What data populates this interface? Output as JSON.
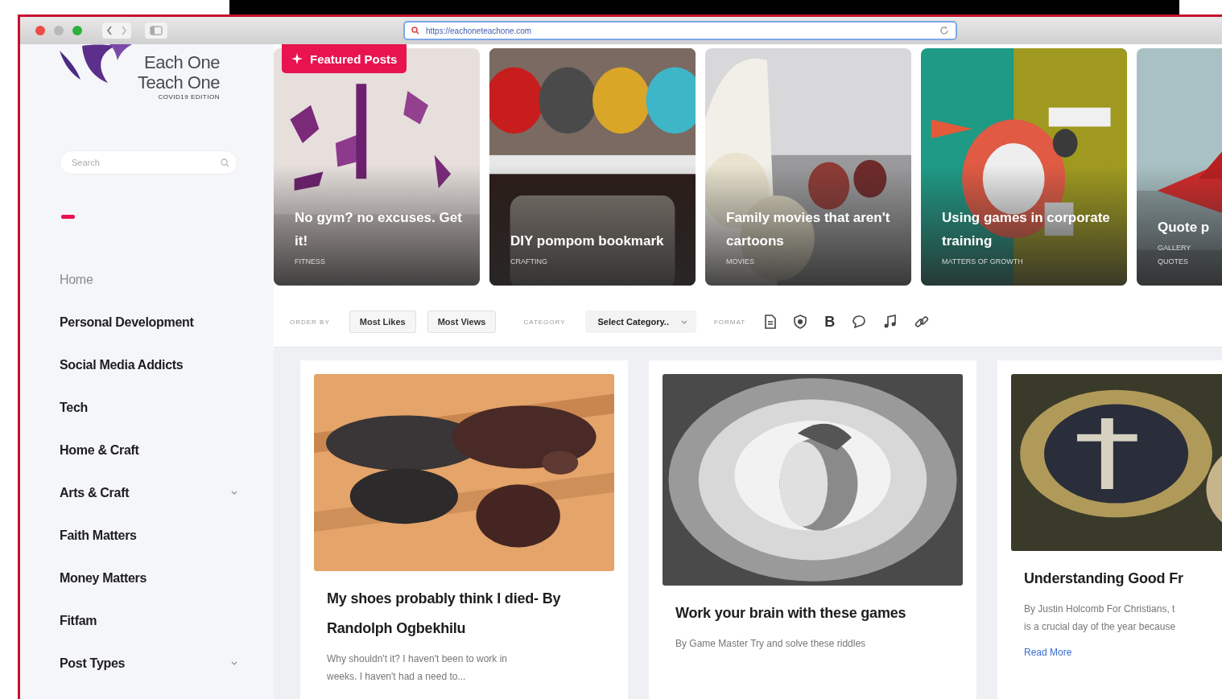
{
  "browser": {
    "url": "https://eachoneteachone.com"
  },
  "sidebar": {
    "logo": {
      "line_1": "Each One",
      "line_2": "Teach One",
      "edition": "COVID19 EDITION"
    },
    "search": {
      "placeholder": "Search"
    },
    "items": [
      {
        "label": "Home",
        "selected": true,
        "has_submenu": false
      },
      {
        "label": "Personal Development",
        "selected": false,
        "has_submenu": false
      },
      {
        "label": "Social Media Addicts",
        "selected": false,
        "has_submenu": false
      },
      {
        "label": "Tech",
        "selected": false,
        "has_submenu": false
      },
      {
        "label": "Home & Craft",
        "selected": false,
        "has_submenu": false
      },
      {
        "label": "Arts & Craft",
        "selected": false,
        "has_submenu": true
      },
      {
        "label": "Faith Matters",
        "selected": false,
        "has_submenu": false
      },
      {
        "label": "Money Matters",
        "selected": false,
        "has_submenu": false
      },
      {
        "label": "Fitfam",
        "selected": false,
        "has_submenu": false
      },
      {
        "label": "Post Types",
        "selected": false,
        "has_submenu": true
      }
    ]
  },
  "featured": {
    "badge": "Featured Posts",
    "posts": [
      {
        "title": "No gym? no excuses. Get it!",
        "meta": [
          "FITNESS"
        ]
      },
      {
        "title": "DIY pompom bookmark",
        "meta": [
          "CRAFTING"
        ]
      },
      {
        "title": "Family movies that aren't cartoons",
        "meta": [
          "MOVIES"
        ]
      },
      {
        "title": "Using games in corporate training",
        "meta": [
          "MATTERS OF GROWTH"
        ]
      },
      {
        "title": "Quote p",
        "meta": [
          "GALLERY",
          "QUOTES"
        ]
      }
    ]
  },
  "filters": {
    "order_label": "ORDER BY",
    "order_buttons": [
      "Most Likes",
      "Most Views"
    ],
    "category_label": "CATEGORY",
    "category_select": "Select Category..",
    "format_label": "FORMAT",
    "bold_format_glyph": "B"
  },
  "posts": [
    {
      "title": "My shoes probably think I died- By Randolph Ogbekhilu",
      "excerpt_lines": [
        "Why shouldn't it? I haven't been to work in",
        "weeks. I haven't had a need to..."
      ]
    },
    {
      "title": "Work your brain with these games",
      "excerpt_lines": [
        "By Game Master Try and solve these riddles"
      ]
    },
    {
      "title": "Understanding Good Fr",
      "excerpt_lines": [
        "By Justin Holcomb For Christians, t",
        "is a crucial day of the year because"
      ],
      "link": "Read More"
    }
  ]
}
